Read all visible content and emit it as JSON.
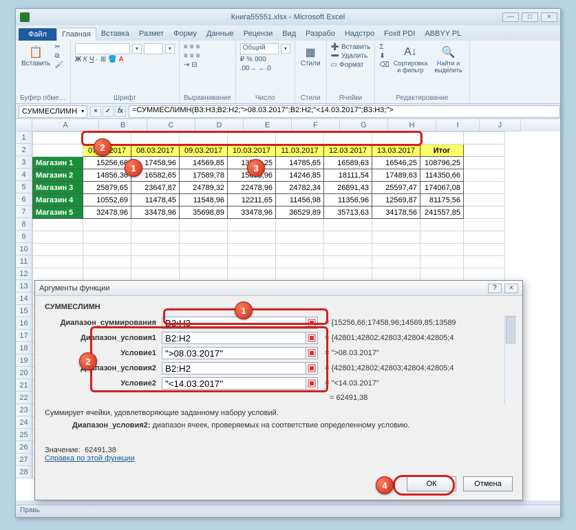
{
  "title": "Книга55551.xlsx - Microsoft Excel",
  "tabs": {
    "file": "Файл",
    "list": [
      "Главная",
      "Вставка",
      "Размет",
      "Форму",
      "Данные",
      "Рецензи",
      "Вид",
      "Разрабо",
      "Надстро",
      "Foxit PDI",
      "ABBYY PL"
    ],
    "active": 0
  },
  "ribbon": {
    "clipboard": {
      "label": "Буфер обме…",
      "paste": "Вставить"
    },
    "font": {
      "label": "Шрифт",
      "family": "",
      "size": ""
    },
    "align": {
      "label": "Выравнивание"
    },
    "number": {
      "label": "Число",
      "fmt": "Общий"
    },
    "styles": {
      "label": "Стили",
      "btn": "Стили"
    },
    "cells": {
      "label": "Ячейки",
      "insert": "Вставить",
      "delete": "Удалить",
      "format": "Формат"
    },
    "editing": {
      "label": "Редактирование",
      "sort": "Сортировка и фильтр",
      "find": "Найти и выделить"
    }
  },
  "fbar": {
    "name": "СУММЕСЛИМН",
    "formula": "=СУММЕСЛИМН(B3:H3;B2:H2;\">08.03.2017\";B2:H2;\"<14.03.2017\";B3:H3;\">"
  },
  "cols": [
    "A",
    "B",
    "C",
    "D",
    "E",
    "F",
    "G",
    "H",
    "I",
    "J"
  ],
  "rows": [
    "1",
    "2",
    "3",
    "4",
    "5",
    "6",
    "7",
    "8",
    "9",
    "10",
    "11",
    "12",
    "13",
    "14",
    "15",
    "16",
    "17",
    "18",
    "19",
    "20",
    "21",
    "22",
    "23",
    "24",
    "25",
    "26",
    "27",
    "28"
  ],
  "dates": [
    "07.03.2017",
    "08.03.2017",
    "09.03.2017",
    "10.03.2017",
    "11.03.2017",
    "12.03.2017",
    "13.03.2017"
  ],
  "itog": "Итог",
  "shops": [
    {
      "name": "Магазин 1",
      "vals": [
        "15256,66",
        "17458,96",
        "14569,85",
        "13589,25",
        "14785,65",
        "16589,63",
        "16546,25"
      ],
      "total": "108796,25"
    },
    {
      "name": "Магазин 2",
      "vals": [
        "14856,36",
        "16582,65",
        "17589,78",
        "15678,96",
        "14246,85",
        "18111,54",
        "17489,63"
      ],
      "total": "114350,66"
    },
    {
      "name": "Магазин 3",
      "vals": [
        "25879,65",
        "23647,87",
        "24789,32",
        "22478,96",
        "24782,34",
        "26891,43",
        "25597,47"
      ],
      "total": "174067,08"
    },
    {
      "name": "Магазин 4",
      "vals": [
        "10552,69",
        "11478,45",
        "11548,96",
        "12211,65",
        "11456,98",
        "11356,96",
        "12569,87"
      ],
      "total": "81175,56"
    },
    {
      "name": "Магазин 5",
      "vals": [
        "32478,96",
        "33478,96",
        "35698,89",
        "33478,96",
        "36529,89",
        "35713,63",
        "34178,56"
      ],
      "total": "241557,85"
    }
  ],
  "dialog": {
    "title": "Аргументы функции",
    "fn": "СУММЕСЛИМН",
    "args": [
      {
        "label": "Диапазон_суммирования",
        "val": "B3:H3",
        "res": "{15256,66;17458,96;14569,85;13589"
      },
      {
        "label": "Диапазон_условия1",
        "val": "B2:H2",
        "res": "{42801;42802;42803;42804;42805;4"
      },
      {
        "label": "Условие1",
        "val": "\">08.03.2017\"",
        "res": "\">08.03.2017\""
      },
      {
        "label": "Диапазон_условия2",
        "val": "B2:H2",
        "res": "{42801;42802;42803;42804;42805;4"
      },
      {
        "label": "Условие2",
        "val": "\"<14.03.2017\"",
        "res": "\"<14.03.2017\""
      }
    ],
    "calc": "= 62491,38",
    "desc": "Суммирует ячейки, удовлетворяющие заданному набору условий.",
    "argdesc_label": "Диапазон_условия2:",
    "argdesc_text": "диапазон ячеек, проверяемых на соответствие определенному условию.",
    "result_label": "Значение:",
    "result": "62491,38",
    "help": "Справка по этой функции",
    "ok": "ОК",
    "cancel": "Отмена"
  },
  "status": "Правь"
}
